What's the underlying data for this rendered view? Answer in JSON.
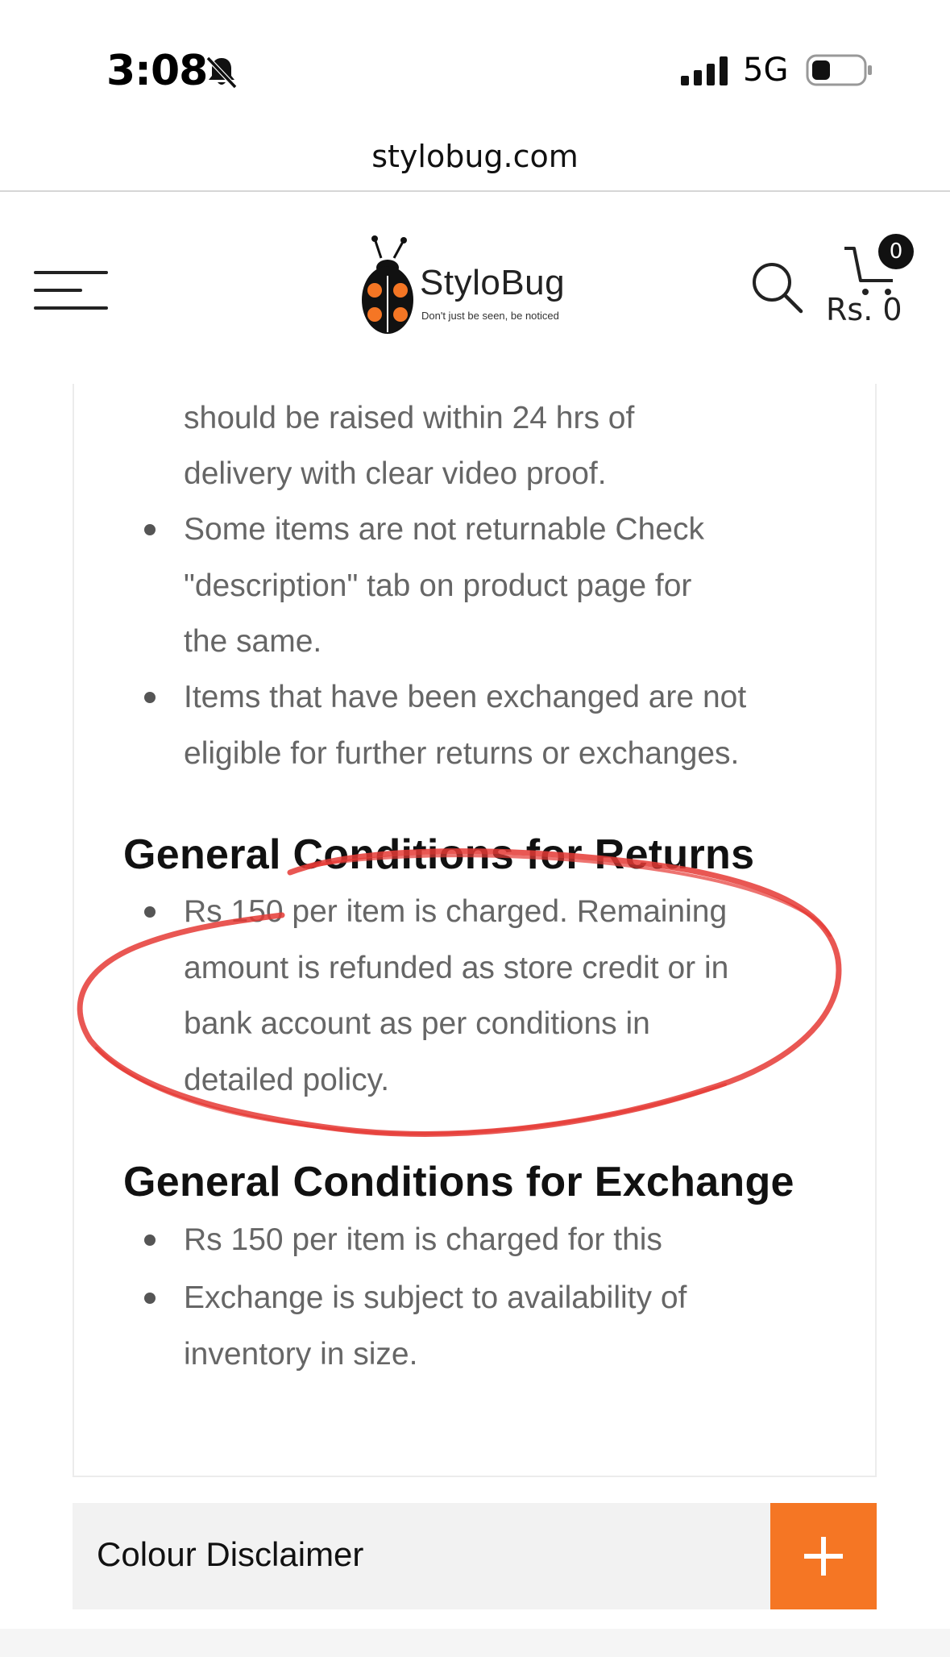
{
  "status_bar": {
    "time": "3:08",
    "network": "5G",
    "icons": [
      "bell-slash-icon",
      "signal-icon",
      "battery-icon"
    ]
  },
  "browser": {
    "url": "stylobug.com"
  },
  "header": {
    "logo_text": "StyloBug",
    "logo_tagline": "Don't just be seen, be noticed",
    "cart_count": "0",
    "cart_total": "Rs. 0",
    "icons": [
      "menu-icon",
      "search-icon",
      "cart-icon"
    ]
  },
  "policy": {
    "intro_lines": [
      "should be raised within 24 hrs of",
      "delivery with clear video proof."
    ],
    "intro_items": [
      {
        "lines": [
          "Some items are not returnable Check",
          "\"description\" tab on product page for",
          "the same."
        ]
      },
      {
        "lines": [
          "Items that have been exchanged are not",
          "eligible for further returns or exchanges."
        ]
      }
    ],
    "returns": {
      "heading": "General Conditions for Returns",
      "items": [
        {
          "lines": [
            "Rs 150 per item is charged. Remaining",
            "amount is refunded as store credit or in",
            "bank account as per conditions in",
            "detailed policy."
          ]
        }
      ]
    },
    "exchange": {
      "heading": "General Conditions for Exchange",
      "items": [
        {
          "lines": [
            "Rs 150 per item is charged for this"
          ]
        },
        {
          "lines": [
            "Exchange is subject to availability of",
            "inventory in size."
          ]
        }
      ]
    }
  },
  "accordion": {
    "label": "Colour Disclaimer",
    "toggle_icon": "plus-icon"
  },
  "colors": {
    "accent": "#f57624",
    "annotation": "#e53935",
    "body_text": "#666666",
    "heading_text": "#111111"
  }
}
